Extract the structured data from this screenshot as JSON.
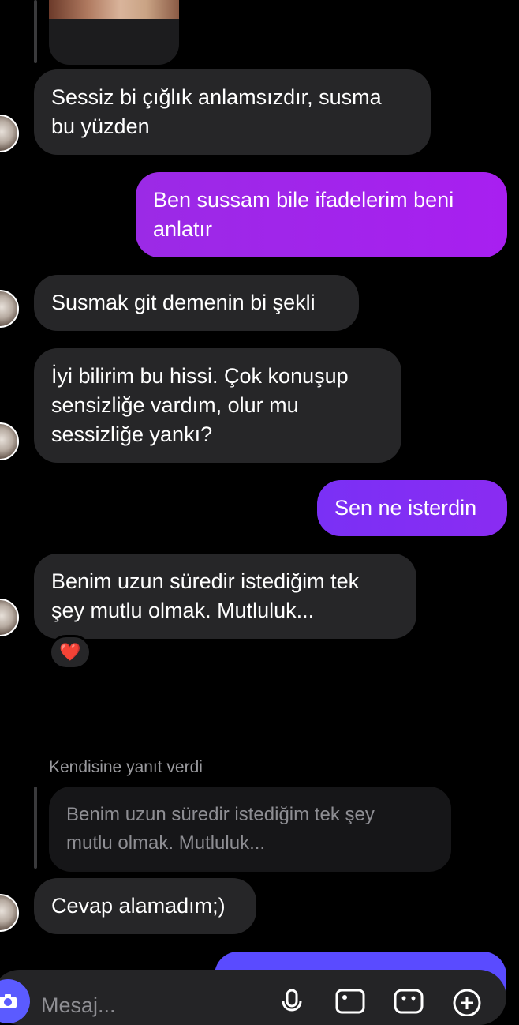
{
  "messages": [
    {
      "id": "m1",
      "side": "in",
      "text_lines": [
        "Sessiz bi çığlık anlamsızdır, susma",
        "bu yüzden"
      ]
    },
    {
      "id": "m2",
      "side": "out",
      "text_lines": [
        "Ben sussam bile ifadelerim beni",
        "anlatır"
      ]
    },
    {
      "id": "m3",
      "side": "in",
      "text_lines": [
        "Susmak git demenin bi şekli"
      ]
    },
    {
      "id": "m4",
      "side": "in",
      "text_lines": [
        "İyi bilirim bu hissi. Çok konuşup",
        "sensizliğe vardım, olur mu",
        "sessizliğe yankı?"
      ]
    },
    {
      "id": "m5",
      "side": "out",
      "text_lines": [
        "Sen ne isterdin"
      ]
    },
    {
      "id": "m6",
      "side": "in",
      "text_lines": [
        "Benim uzun süredir istediğim tek",
        "şey mutlu olmak. Mutluluk..."
      ],
      "reaction": "❤️"
    },
    {
      "id": "m7",
      "side": "in",
      "text_lines": [
        "Cevap alamadım;)"
      ]
    }
  ],
  "reply": {
    "label": "Kendisine yanıt verdi",
    "quoted_lines": [
      "Benim uzun süredir istediğim tek şey",
      "mutlu olmak. Mutluluk..."
    ]
  },
  "composer": {
    "placeholder": "Mesaj...",
    "icons": [
      "camera-icon",
      "microphone-icon",
      "gallery-icon",
      "sticker-icon",
      "plus-icon"
    ]
  },
  "colors": {
    "incoming_bubble": "#262628",
    "outgoing_violet": "#a81ff0",
    "outgoing_purple": "#7d2ff5",
    "composer_accent": "#5b5bff"
  }
}
